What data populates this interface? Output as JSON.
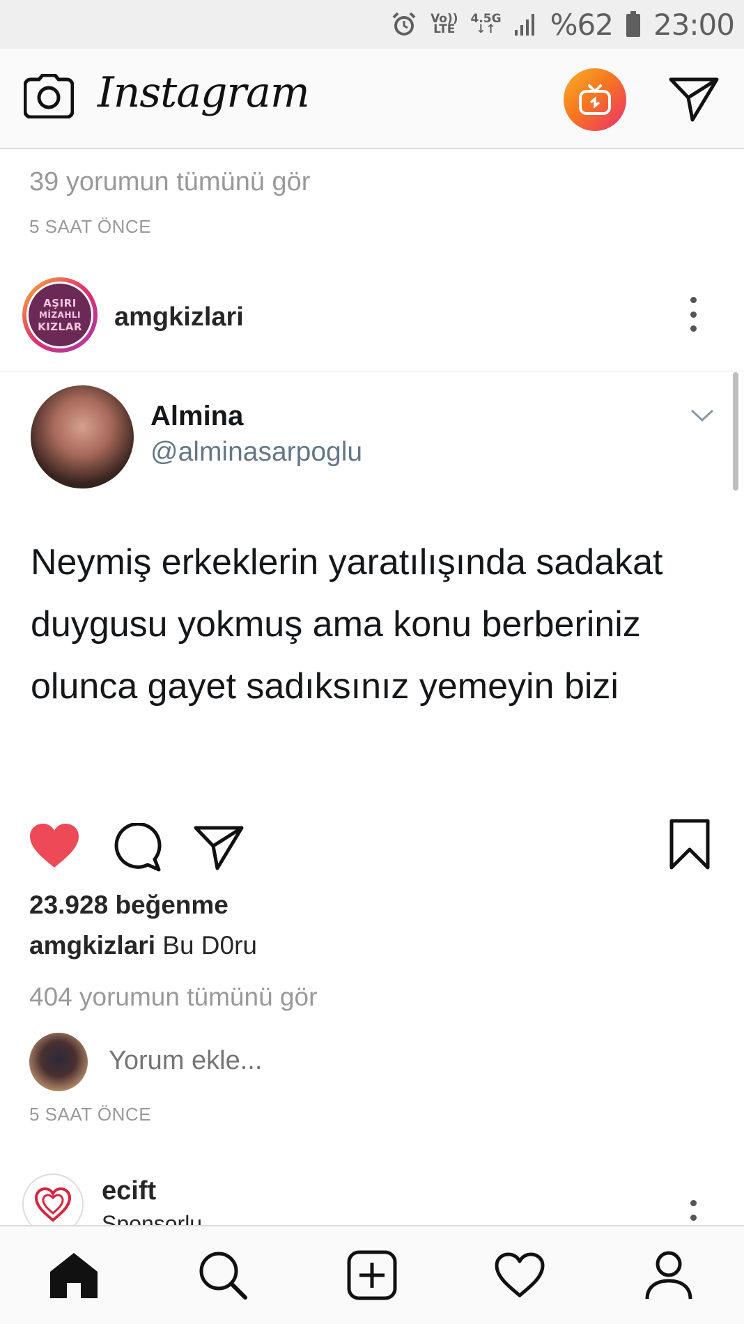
{
  "status_bar": {
    "volte_top": "Vo))",
    "volte_bottom": "LTE",
    "network_top": "4.5G",
    "network_bottom": "↓↑",
    "battery_percent": "%62",
    "time": "23:00"
  },
  "header": {
    "logo": "Instagram",
    "icons": [
      "camera-icon",
      "igtv-icon",
      "direct-icon"
    ],
    "igtv_gradient": [
      "#f7b02a",
      "#ea2e6d"
    ]
  },
  "previous_post": {
    "view_comments": "39 yorumun tümünü gör",
    "timestamp": "5 SAAT ÖNCE"
  },
  "post": {
    "username": "amgkizlari",
    "avatar_text": [
      "AŞIRI",
      "MİZAHLI",
      "KIZLAR"
    ],
    "tweet": {
      "name": "Almina",
      "handle": "@alminasarpoglu",
      "text": "Neymiş erkeklerin yaratılışında sadakat duygusu yokmuş ama konu berberiniz olunca gayet sadıksınız yemeyin bizi"
    },
    "liked": true,
    "like_color": "#ed4956",
    "likes": "23.928 beğenme",
    "caption_user": "amgkizlari",
    "caption_text": "Bu D0ru",
    "view_comments": "404 yorumun tümünü gör",
    "comment_placeholder": "Yorum ekle...",
    "timestamp": "5 SAAT ÖNCE"
  },
  "next_post": {
    "username": "ecift",
    "subtitle": "Sponsorlu"
  },
  "bottom_nav": [
    "home-icon",
    "search-icon",
    "add-post-icon",
    "activity-heart-icon",
    "profile-icon"
  ]
}
